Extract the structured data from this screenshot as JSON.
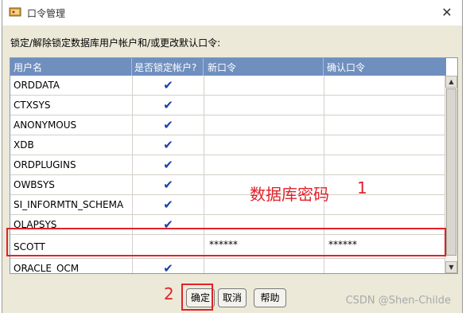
{
  "window": {
    "title": "口令管理",
    "close_glyph": "✕"
  },
  "instructions": "锁定/解除锁定数据库用户帐户和/或更改默认口令:",
  "table": {
    "headers": [
      "用户名",
      "是否锁定帐户?",
      "新口令",
      "确认口令"
    ],
    "rows": [
      {
        "user": "ORDDATA",
        "locked": "✔",
        "new_pw": "",
        "confirm_pw": ""
      },
      {
        "user": "CTXSYS",
        "locked": "✔",
        "new_pw": "",
        "confirm_pw": ""
      },
      {
        "user": "ANONYMOUS",
        "locked": "✔",
        "new_pw": "",
        "confirm_pw": ""
      },
      {
        "user": "XDB",
        "locked": "✔",
        "new_pw": "",
        "confirm_pw": ""
      },
      {
        "user": "ORDPLUGINS",
        "locked": "✔",
        "new_pw": "",
        "confirm_pw": ""
      },
      {
        "user": "OWBSYS",
        "locked": "✔",
        "new_pw": "",
        "confirm_pw": ""
      },
      {
        "user": "SI_INFORMTN_SCHEMA",
        "locked": "✔",
        "new_pw": "",
        "confirm_pw": ""
      },
      {
        "user": "OLAPSYS",
        "locked": "✔",
        "new_pw": "",
        "confirm_pw": ""
      },
      {
        "user": "SCOTT",
        "locked": "",
        "new_pw": "******",
        "confirm_pw": "******"
      },
      {
        "user": "ORACLE_OCM",
        "locked": "✔",
        "new_pw": "",
        "confirm_pw": ""
      }
    ]
  },
  "annotations": {
    "db_password_label": "数据库密码",
    "marker_1": "1",
    "marker_2": "2"
  },
  "buttons": {
    "ok": "确定",
    "cancel": "取消",
    "help": "帮助"
  },
  "watermark": "CSDN @Shen-Childe",
  "colors": {
    "header_bg": "#6f8fbf",
    "check": "#1a3fa8",
    "annotation": "#e0222a"
  }
}
